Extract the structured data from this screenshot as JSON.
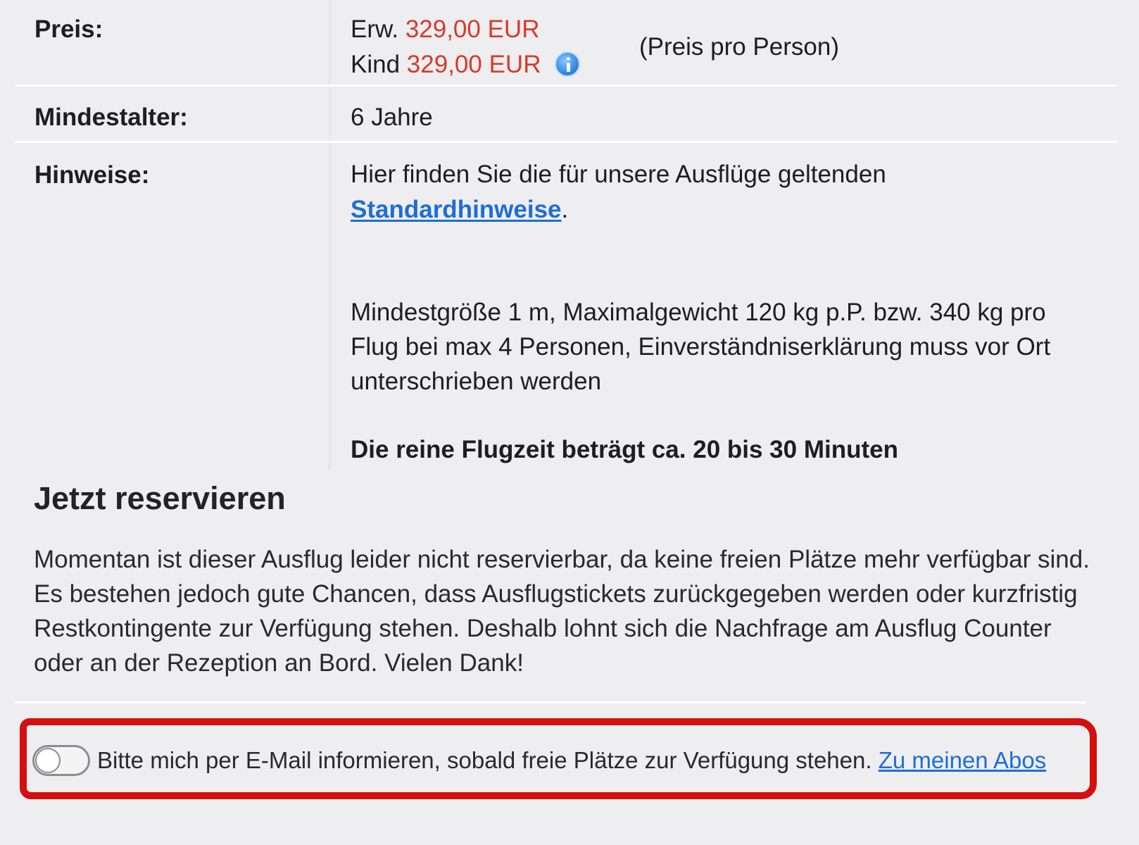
{
  "details": {
    "price": {
      "label": "Preis:",
      "adult_prefix": "Erw.",
      "adult_amount": "329,00 EUR",
      "child_prefix": "Kind",
      "child_amount": "329,00 EUR",
      "info_icon": "info-icon",
      "per_person": "(Preis pro Person)"
    },
    "min_age": {
      "label": "Mindestalter:",
      "value": "6 Jahre"
    },
    "notes": {
      "label": "Hinweise:",
      "intro": "Hier finden Sie die für unsere Ausflüge geltenden",
      "link": "Standardhinweise",
      "link_suffix": ".",
      "detail": "Mindestgröße 1 m, Maximalgewicht 120 kg p.P. bzw. 340 kg pro Flug bei max 4 Personen, Einverständniserklärung muss vor Ort unterschrieben werden",
      "flight_time": "Die reine Flugzeit beträgt ca. 20 bis 30 Minuten"
    }
  },
  "reserve": {
    "title": "Jetzt reservieren",
    "text": "Momentan ist dieser Ausflug leider nicht reservierbar, da keine freien Plätze mehr verfügbar sind. Es bestehen jedoch gute Chancen, dass Ausflugstickets zurückgegeben werden oder kurzfristig Restkontingente zur Verfügung stehen. Deshalb lohnt sich die Nachfrage am Ausflug Counter oder an der Rezeption an Bord. Vielen Dank!"
  },
  "notify": {
    "toggle_state": "off",
    "text": "Bitte mich per E-Mail informieren, sobald freie Plätze zur Verfügung stehen.",
    "link": "Zu meinen Abos"
  },
  "colors": {
    "background": "#eeedef",
    "price": "#d83a2a",
    "link": "#1f6ed4",
    "highlight": "#d40f0f"
  }
}
